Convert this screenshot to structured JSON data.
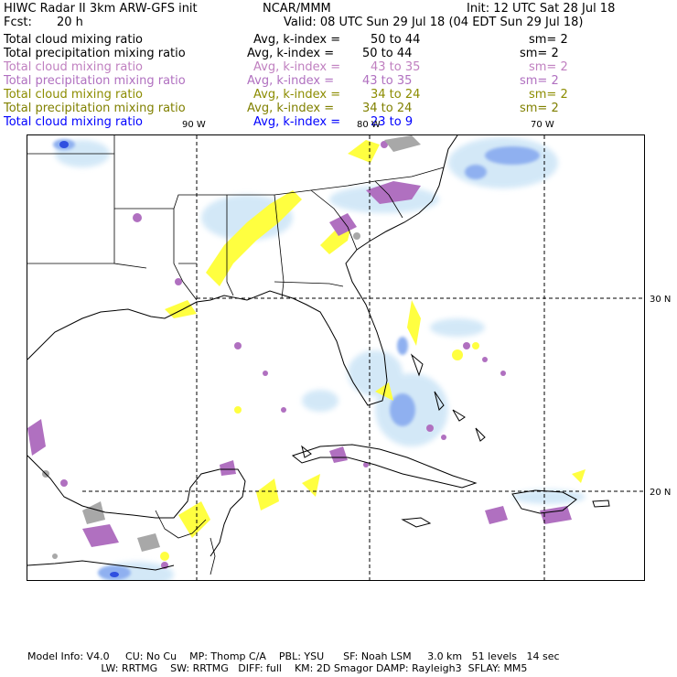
{
  "header": {
    "title": "HIWC Radar II 3km ARW-GFS init",
    "org": "NCAR/MMM",
    "init": "Init: 12 UTC Sat 28 Jul 18",
    "fcst_label": "Fcst:",
    "fcst_value": "20 h",
    "valid": "Valid: 08 UTC Sun 29 Jul 18 (04 EDT Sun 29 Jul 18)"
  },
  "legend": [
    {
      "field": "Total cloud mixing ratio",
      "avg": "Avg, k-index =",
      "range": "50 to 44",
      "sm": "sm= 2",
      "color": "#000000"
    },
    {
      "field": "Total precipitation mixing ratio",
      "avg": "Avg, k-index =",
      "range": "50 to 44",
      "sm": "sm= 2",
      "color": "#000000"
    },
    {
      "field": "Total cloud mixing ratio",
      "avg": "Avg, k-index =",
      "range": "43 to 35",
      "sm": "sm= 2",
      "color": "#c080c0"
    },
    {
      "field": "Total precipitation mixing ratio",
      "avg": "Avg, k-index =",
      "range": "43 to 35",
      "sm": "sm= 2",
      "color": "#b070c0"
    },
    {
      "field": "Total cloud mixing ratio",
      "avg": "Avg, k-index =",
      "range": "34 to 24",
      "sm": "sm= 2",
      "color": "#8c8c00"
    },
    {
      "field": "Total precipitation mixing ratio",
      "avg": "Avg, k-index =",
      "range": "34 to 24",
      "sm": "sm= 2",
      "color": "#808000"
    },
    {
      "field": "Total cloud mixing ratio",
      "avg": "Avg, k-index =",
      "range": "23 to 9",
      "sm": "",
      "color": "#0000ff"
    }
  ],
  "map": {
    "lon_labels": [
      "90 W",
      "80 W",
      "70 W"
    ],
    "lat_labels": [
      "30 N",
      "20 N"
    ]
  },
  "footer": {
    "line1": "Model Info: V4.0     CU: No Cu    MP: Thomp C/A    PBL: YSU      SF: Noah LSM     3.0 km   51 levels   14 sec",
    "line2": "                       LW: RRTMG    SW: RRTMG   DIFF: full    KM: 2D Smagor DAMP: Rayleigh3  SFLAY: MM5"
  }
}
